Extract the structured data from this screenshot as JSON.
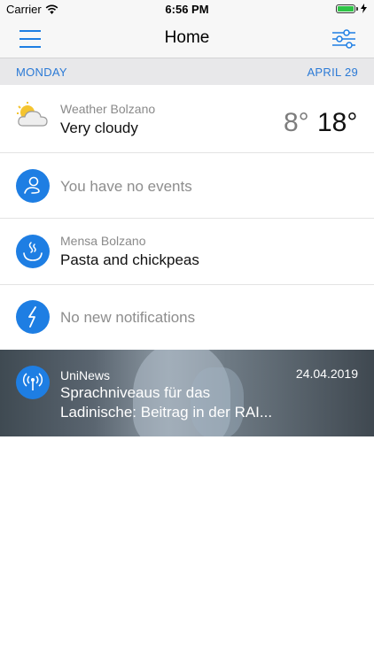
{
  "status": {
    "carrier": "Carrier",
    "time": "6:56 PM",
    "battery_level": 1.0
  },
  "nav": {
    "title": "Home"
  },
  "date": {
    "day": "MONDAY",
    "date": "APRIL 29"
  },
  "weather": {
    "subtitle": "Weather Bolzano",
    "condition": "Very cloudy",
    "temp_low": "8°",
    "temp_high": "18°",
    "icon": "cloudy-weather-icon"
  },
  "events": {
    "text": "You have no events",
    "icon": "person-icon"
  },
  "mensa": {
    "subtitle": "Mensa Bolzano",
    "meal": "Pasta and chickpeas",
    "icon": "steaming-bowl-icon"
  },
  "notifications": {
    "text": "No new notifications",
    "icon": "lightning-icon"
  },
  "news": {
    "source": "UniNews",
    "date": "24.04.2019",
    "title": "Sprachniveaus für das Ladinische: Beitrag in der RAI...",
    "icon": "broadcast-icon"
  },
  "colors": {
    "accent": "#1e7ee3",
    "date_text": "#2b7ad6",
    "date_band": "#e8e8ea"
  }
}
